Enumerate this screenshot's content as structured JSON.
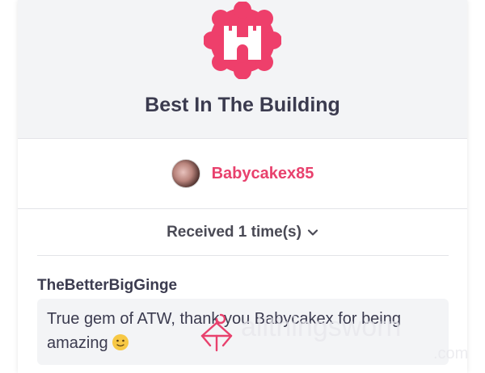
{
  "award": {
    "icon": "castle-icon",
    "title": "Best In The Building",
    "color": "#ee3f6b"
  },
  "giver": {
    "name": "Babycakex85",
    "avatar": "avatar"
  },
  "received": {
    "label": "Received 1 time(s)",
    "icon": "chevron-down-icon"
  },
  "review": {
    "author": "TheBetterBigGinge",
    "text": "True gem of ATW, thank you Babycakex for being amazing",
    "emoji": "slightly-smiling-face"
  },
  "watermark": {
    "text": "allthingsworn",
    "suffix": ".com"
  }
}
